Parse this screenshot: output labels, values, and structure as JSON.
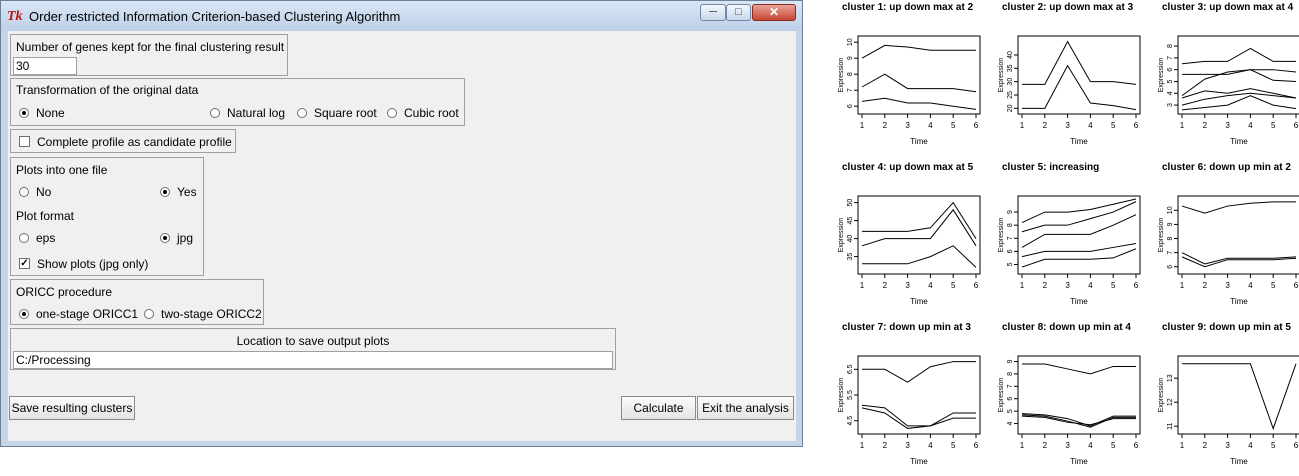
{
  "window": {
    "title": "Order restricted Information Criterion-based Clustering Algorithm",
    "icon": "Tk",
    "controls": [
      "minimize-icon",
      "maximize-icon",
      "close-icon"
    ]
  },
  "genes_section": {
    "label": "Number of genes kept for the final clustering result",
    "value": "30"
  },
  "transform_section": {
    "label": "Transformation of the original data",
    "options": [
      "None",
      "Natural log",
      "Square root",
      "Cubic root"
    ],
    "selected": "None"
  },
  "complete_profile": {
    "label": "Complete profile as candidate profile",
    "checked": false
  },
  "plots_section": {
    "one_file_label": "Plots into one file",
    "one_file_options": [
      "No",
      "Yes"
    ],
    "one_file_selected": "Yes",
    "format_label": "Plot format",
    "format_options": [
      "eps",
      "jpg"
    ],
    "format_selected": "jpg",
    "show_plots_label": "Show plots (jpg only)",
    "show_plots_checked": true
  },
  "procedure_section": {
    "label": "ORICC procedure",
    "options": [
      "one-stage ORICC1",
      "two-stage ORICC2"
    ],
    "selected": "one-stage ORICC1"
  },
  "location_section": {
    "label": "Location to save output plots",
    "value": "C:/Processing"
  },
  "buttons": {
    "save": "Save resulting clusters",
    "calculate": "Calculate",
    "exit": "Exit the analysis"
  },
  "plots": {
    "xlabel": "Time",
    "ylabel": "Expression",
    "x_ticks": [
      "1",
      "2",
      "3",
      "4",
      "5",
      "6"
    ],
    "panels": [
      {
        "title": "cluster 1: up down max at 2",
        "yticks": [
          6,
          7,
          8,
          9,
          10
        ],
        "ylim": [
          5.7,
          10.2
        ],
        "lines": [
          [
            9.0,
            9.8,
            9.7,
            9.5,
            9.5,
            9.5
          ],
          [
            7.2,
            8.0,
            7.1,
            7.1,
            7.1,
            6.9
          ],
          [
            6.3,
            6.5,
            6.2,
            6.2,
            6.0,
            5.8
          ]
        ]
      },
      {
        "title": "cluster 2: up down max at 3",
        "yticks": [
          20,
          25,
          30,
          35,
          40
        ],
        "ylim": [
          19,
          46
        ],
        "lines": [
          [
            29,
            29,
            45,
            30,
            30,
            29
          ],
          [
            20,
            20,
            36,
            22,
            21,
            19.5
          ]
        ]
      },
      {
        "title": "cluster 3: up down max at 4",
        "yticks": [
          3,
          4,
          5,
          6,
          7,
          8
        ],
        "ylim": [
          2.5,
          8.6
        ],
        "lines": [
          [
            6.5,
            6.7,
            6.7,
            7.8,
            6.7,
            6.7
          ],
          [
            3.8,
            5.2,
            5.8,
            6.0,
            6.0,
            5.8
          ],
          [
            5.6,
            5.6,
            5.6,
            6.0,
            5.1,
            5.0
          ],
          [
            3.6,
            4.2,
            4.0,
            4.4,
            4.0,
            3.6
          ],
          [
            3.0,
            3.5,
            3.8,
            4.0,
            3.8,
            3.6
          ],
          [
            2.6,
            2.8,
            3.0,
            3.8,
            3.0,
            2.7
          ]
        ]
      },
      {
        "title": "cluster 4: up down max at 5",
        "yticks": [
          35,
          40,
          45,
          50
        ],
        "ylim": [
          31,
          51
        ],
        "lines": [
          [
            42,
            42,
            42,
            43,
            50,
            40
          ],
          [
            38,
            40,
            40,
            40,
            48,
            38
          ],
          [
            33,
            33,
            33,
            35,
            38,
            32
          ]
        ]
      },
      {
        "title": "cluster 5: increasing",
        "yticks": [
          5,
          6,
          7,
          8,
          9
        ],
        "ylim": [
          4.5,
          10
        ],
        "lines": [
          [
            8.2,
            9.0,
            9.0,
            9.2,
            9.6,
            10.0
          ],
          [
            7.5,
            8.0,
            8.0,
            8.5,
            9.0,
            9.8
          ],
          [
            6.3,
            7.3,
            7.3,
            7.3,
            8.0,
            8.8
          ],
          [
            5.6,
            6.0,
            6.0,
            6.0,
            6.3,
            6.6
          ],
          [
            4.8,
            5.4,
            5.4,
            5.4,
            5.5,
            6.2
          ]
        ]
      },
      {
        "title": "cluster 6: down up min at 2",
        "yticks": [
          6,
          7,
          8,
          9,
          10
        ],
        "ylim": [
          5.7,
          10.8
        ],
        "lines": [
          [
            10.3,
            9.8,
            10.3,
            10.5,
            10.6,
            10.6
          ],
          [
            7.0,
            6.2,
            6.6,
            6.6,
            6.6,
            6.7
          ],
          [
            6.7,
            6.0,
            6.5,
            6.5,
            6.5,
            6.6
          ]
        ]
      },
      {
        "title": "cluster 7: down up min at 3",
        "yticks": [
          4.5,
          5.5,
          6.5
        ],
        "ylim": [
          4.1,
          6.9
        ],
        "lines": [
          [
            6.5,
            6.5,
            6.0,
            6.6,
            6.8,
            6.8
          ],
          [
            5.1,
            5.0,
            4.3,
            4.3,
            4.8,
            4.8
          ],
          [
            5.0,
            4.8,
            4.2,
            4.3,
            4.6,
            4.6
          ]
        ]
      },
      {
        "title": "cluster 8: down up min at 4",
        "yticks": [
          4,
          5,
          6,
          7,
          8,
          9
        ],
        "ylim": [
          3.4,
          9.2
        ],
        "lines": [
          [
            8.8,
            8.8,
            8.4,
            8.0,
            8.6,
            8.6
          ],
          [
            4.8,
            4.7,
            4.4,
            3.8,
            4.6,
            4.6
          ],
          [
            4.7,
            4.6,
            4.2,
            3.7,
            4.5,
            4.5
          ],
          [
            4.6,
            4.5,
            4.1,
            3.9,
            4.4,
            4.4
          ]
        ]
      },
      {
        "title": "cluster 9: down up min at 5",
        "yticks": [
          11.0,
          12.0,
          13.0
        ],
        "ylim": [
          10.8,
          13.8
        ],
        "lines": [
          [
            13.6,
            13.6,
            13.6,
            13.6,
            10.9,
            13.6
          ]
        ]
      }
    ]
  }
}
